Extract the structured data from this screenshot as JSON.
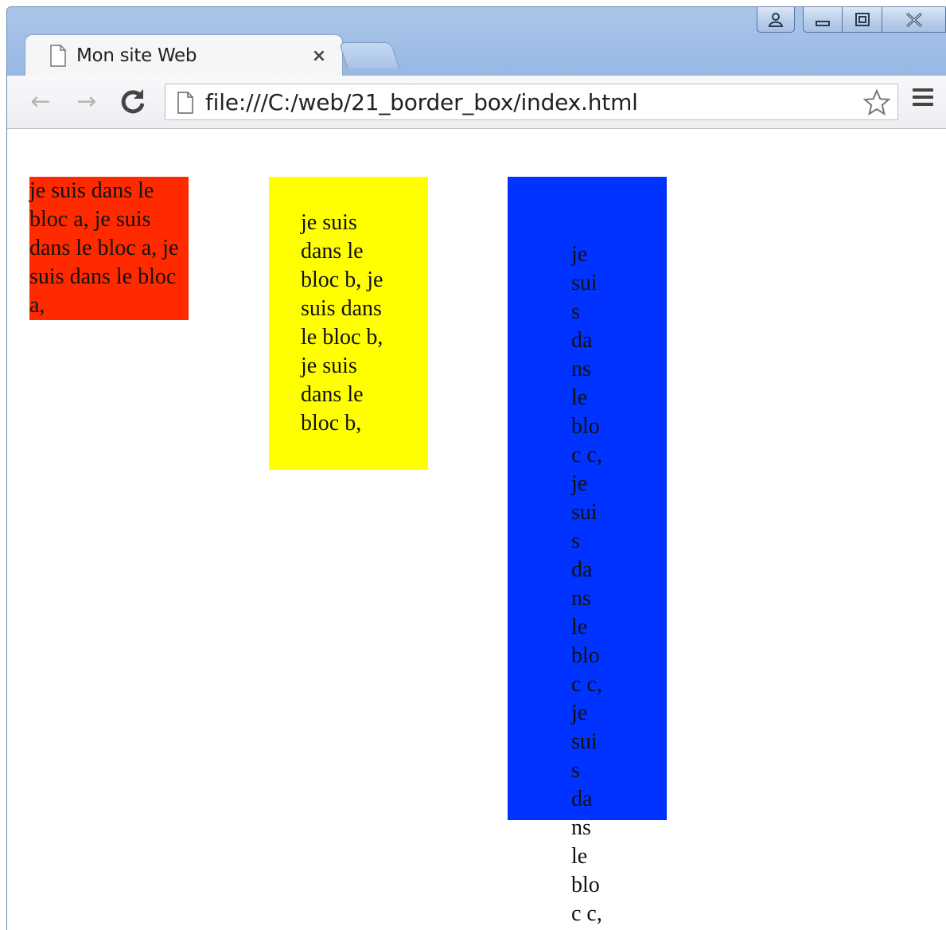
{
  "tab": {
    "title": "Mon site Web",
    "close_glyph": "×"
  },
  "toolbar": {
    "url": "file:///C:/web/21_border_box/index.html",
    "back_glyph": "←",
    "forward_glyph": "→",
    "reload_glyph": "C"
  },
  "page": {
    "block_a": {
      "text": "je suis dans le bloc a, je suis dans le bloc a, je suis dans le bloc a,",
      "color": "#ff2a00"
    },
    "block_b": {
      "text": "je suis dans le bloc b, je suis dans le bloc b, je suis dans le bloc b,",
      "color": "#ffff00"
    },
    "block_c": {
      "text": "je suis dans le bloc c, je suis dans le bloc c, je suis dans le bloc c,",
      "color": "#0033ff"
    }
  },
  "icons": [
    "profile-icon",
    "minimize-icon",
    "maximize-icon",
    "close-window-icon",
    "page-icon",
    "star-icon",
    "menu-icon"
  ]
}
